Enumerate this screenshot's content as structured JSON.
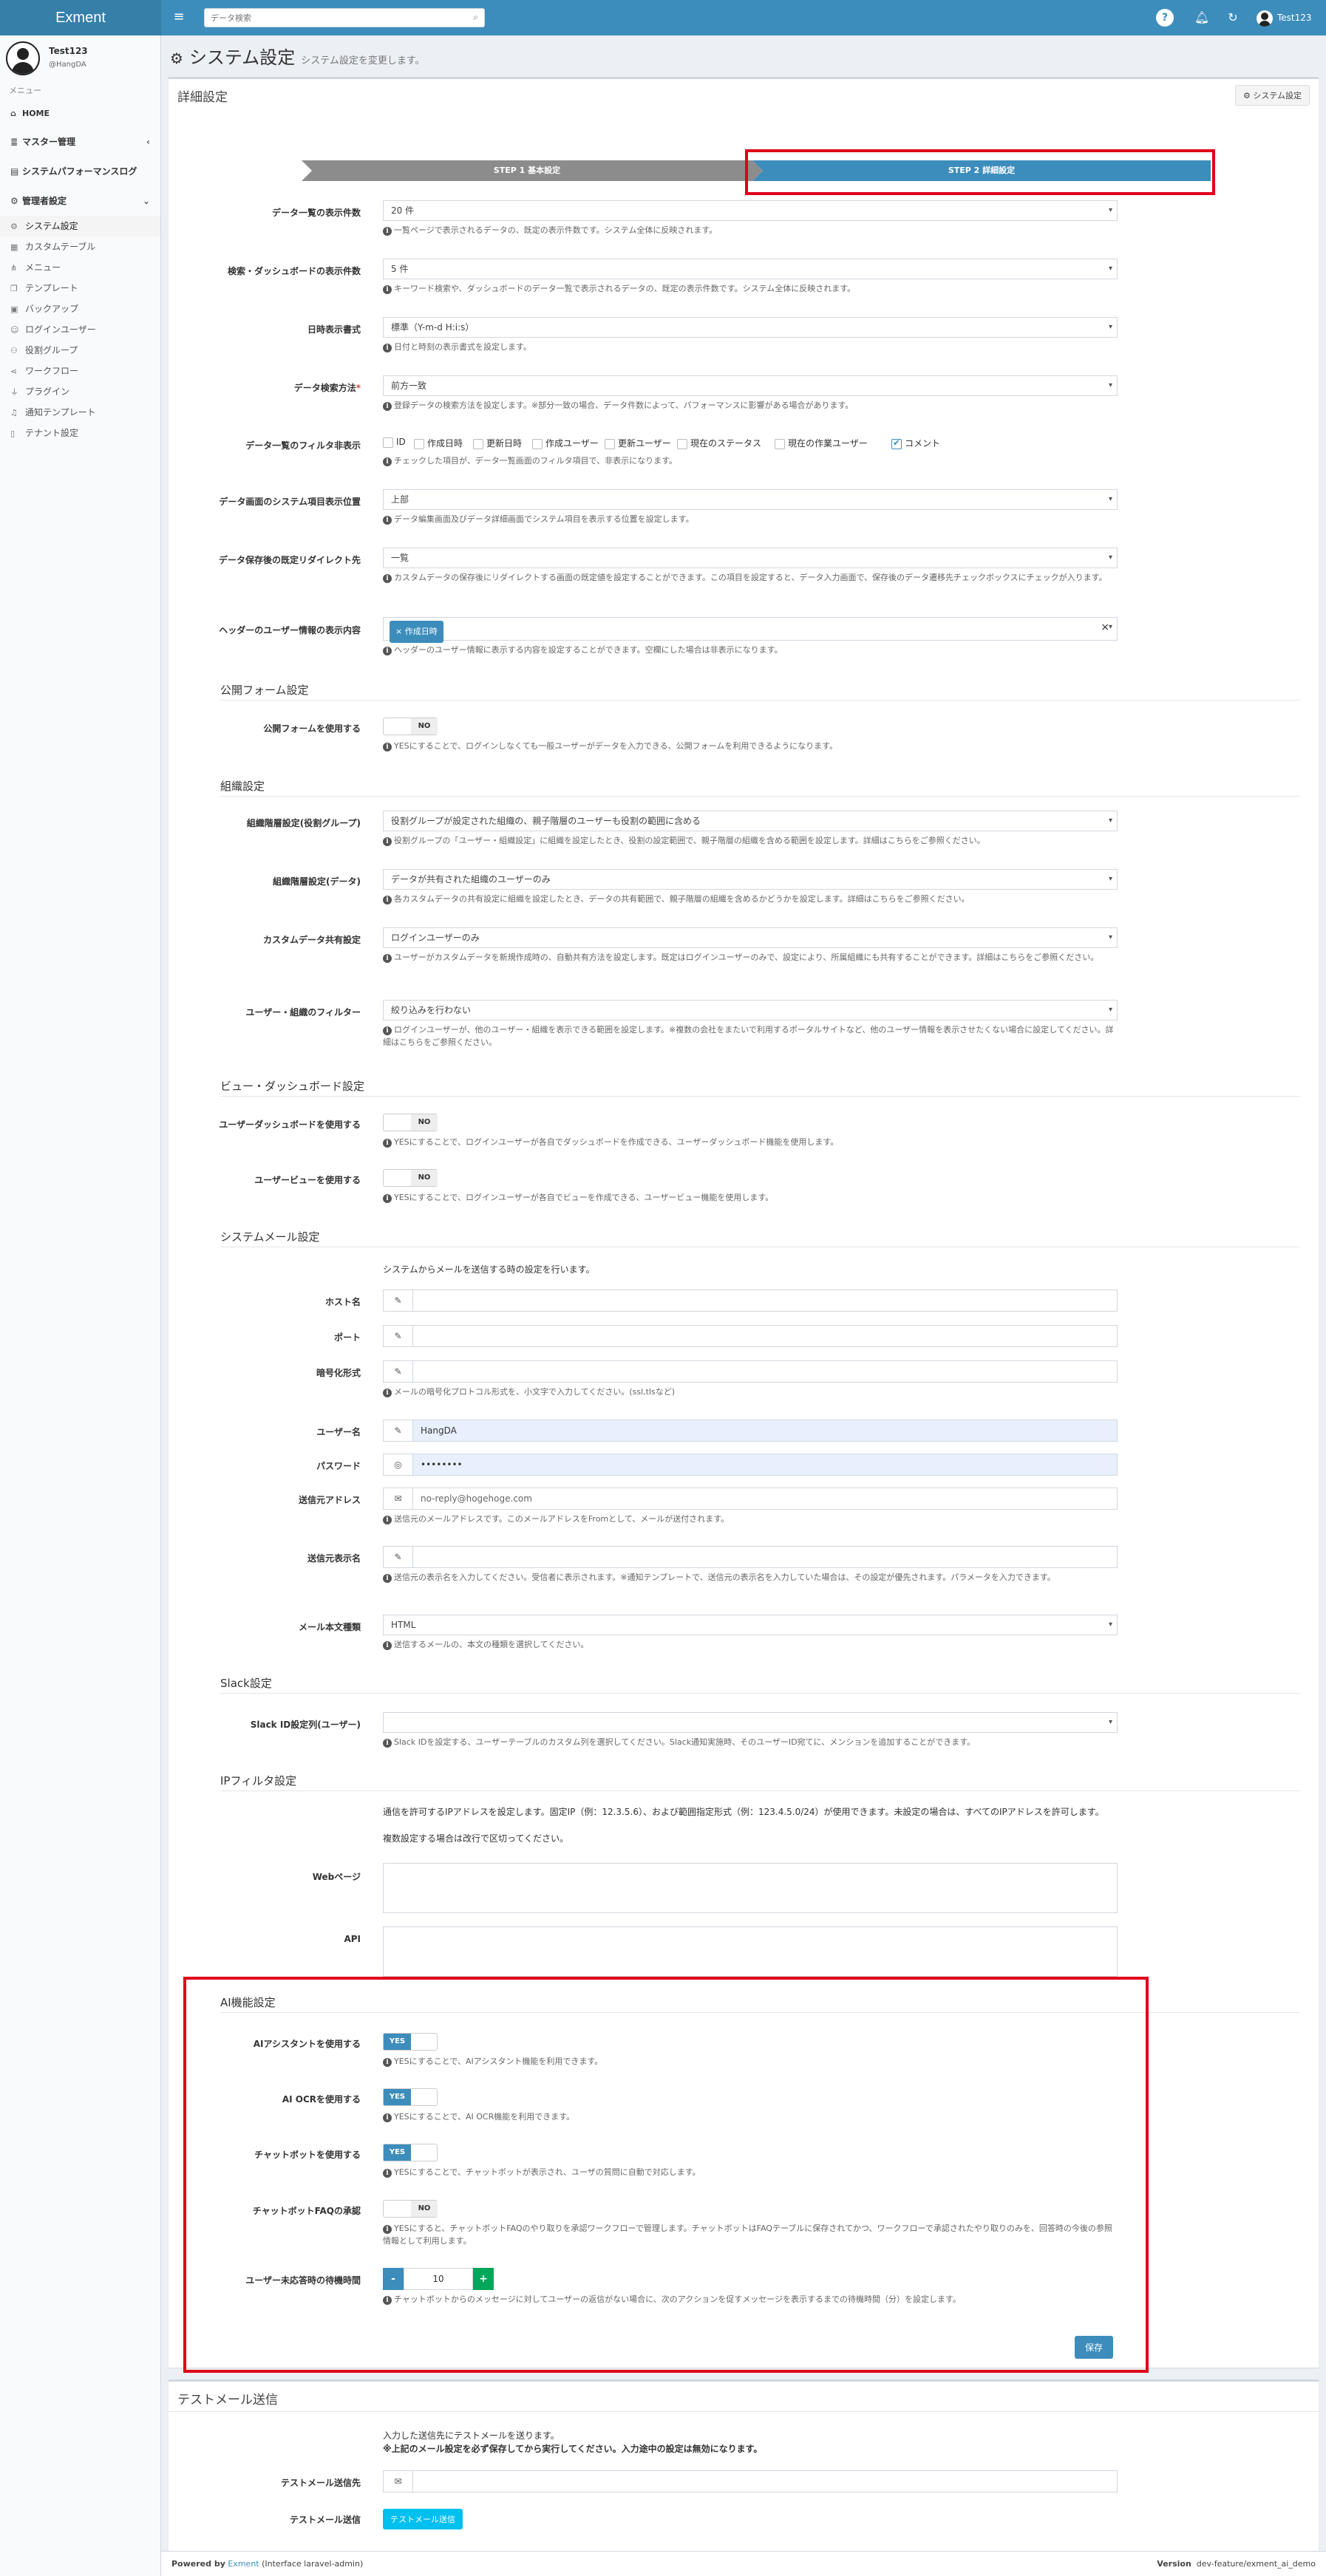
{
  "app": {
    "logo": "Exment",
    "user_name": "Test123"
  },
  "search": {
    "placeholder": "データ検索"
  },
  "sidebar": {
    "user_name": "Test123",
    "user_id": "@HangDA",
    "menu_header": "メニュー",
    "items": [
      {
        "label": "HOME",
        "icon": "home-icon"
      },
      {
        "label": "マスター管理",
        "icon": "database-icon"
      },
      {
        "label": "システムパフォーマンスログ",
        "icon": "log-icon"
      },
      {
        "label": "管理者設定",
        "icon": "gear-icon"
      }
    ],
    "sub_items": [
      "システム設定",
      "カスタムテーブル",
      "メニュー",
      "テンプレート",
      "バックアップ",
      "ログインユーザー",
      "役割グループ",
      "ワークフロー",
      "プラグイン",
      "通知テンプレート",
      "テナント設定"
    ]
  },
  "page": {
    "title": "システム設定",
    "subtitle": "システム設定を変更します。"
  },
  "detail_box": {
    "title": "詳細設定",
    "setting_button": "システム設定",
    "step1": "STEP 1 基本設定",
    "step2": "STEP 2 詳細設定",
    "rows": [
      {
        "label": "データ一覧の表示件数",
        "value": "20 件",
        "help": "一覧ページで表示されるデータの、既定の表示件数です。システム全体に反映されます。"
      },
      {
        "label": "検索・ダッシュボードの表示件数",
        "value": "5 件",
        "help": "キーワード検索や、ダッシュボードのデータ一覧で表示されるデータの、既定の表示件数です。システム全体に反映されます。"
      },
      {
        "label": "日時表示書式",
        "value": "標準（Y-m-d H:i:s）",
        "help": "日付と時刻の表示書式を設定します。"
      },
      {
        "label": "データ検索方法",
        "value": "前方一致",
        "help": "登録データの検索方法を設定します。※部分一致の場合、データ件数によって、パフォーマンスに影響がある場合があります。"
      },
      {
        "label": "データ画面のシステム項目表示位置",
        "value": "上部",
        "help": "データ編集画面及びデータ詳細画面でシステム項目を表示する位置を設定します。"
      },
      {
        "label": "データ保存後の既定リダイレクト先",
        "value": "一覧",
        "help": "カスタムデータの保存後にリダイレクトする画面の既定値を設定することができます。この項目を設定すると、データ入力画面で、保存後のデータ遷移先チェックボックスにチェックが入ります。"
      }
    ],
    "filter_row": {
      "label": "データ一覧のフィルタ非表示",
      "options": [
        "ID",
        "作成日時",
        "更新日時",
        "作成ユーザー",
        "更新ユーザー",
        "現在のステータス",
        "現在の作業ユーザー",
        "コメント"
      ],
      "checked": "コメント",
      "help": "チェックした項目が、データ一覧画面のフィルタ項目で、非表示になります。"
    },
    "header_row": {
      "label": "ヘッダーのユーザー情報の表示内容",
      "tag": "× 作成日時",
      "clear": "×",
      "help": "ヘッダーのユーザー情報に表示する内容を設定することができます。空欄にした場合は非表示になります。"
    },
    "public_form": {
      "title": "公開フォーム設定",
      "label": "公開フォームを使用する",
      "toggle": "NO",
      "help": "YESにすることで、ログインしなくても一般ユーザーがデータを入力できる、公開フォームを利用できるようになります。"
    },
    "org": {
      "title": "組織設定",
      "rows": [
        {
          "label": "組織階層設定(役割グループ)",
          "value": "役割グループが設定された組織の、親子階層のユーザーも役割の範囲に含める",
          "help": "役割グループの「ユーザー・組織設定」に組織を設定したとき、役割の設定範囲で、親子階層の組織を含める範囲を設定します。詳細はこちらをご参照ください。"
        },
        {
          "label": "組織階層設定(データ)",
          "value": "データが共有された組織のユーザーのみ",
          "help": "各カスタムデータの共有設定に組織を設定したとき、データの共有範囲で、親子階層の組織を含めるかどうかを設定します。詳細はこちらをご参照ください。"
        },
        {
          "label": "カスタムデータ共有設定",
          "value": "ログインユーザーのみ",
          "help": "ユーザーがカスタムデータを新規作成時の、自動共有方法を設定します。既定はログインユーザーのみで、設定により、所属組織にも共有することができます。詳細はこちらをご参照ください。"
        },
        {
          "label": "ユーザー・組織のフィルター",
          "value": "絞り込みを行わない",
          "help": "ログインユーザーが、他のユーザー・組織を表示できる範囲を設定します。※複数の会社をまたいで利用するポータルサイトなど、他のユーザー情報を表示させたくない場合に設定してください。詳細はこちらをご参照ください。"
        }
      ]
    },
    "view": {
      "title": "ビュー・ダッシュボード設定",
      "rows": [
        {
          "label": "ユーザーダッシュボードを使用する",
          "toggle": "NO",
          "help": "YESにすることで、ログインユーザーが各自でダッシュボードを作成できる、ユーザーダッシュボード機能を使用します。"
        },
        {
          "label": "ユーザービューを使用する",
          "toggle": "NO",
          "help": "YESにすることで、ログインユーザーが各自でビューを作成できる、ユーザービュー機能を使用します。"
        }
      ]
    },
    "mail": {
      "title": "システムメール設定",
      "desc": "システムからメールを送信する時の設定を行います。",
      "host": "ホスト名",
      "port": "ポート",
      "encryption": "暗号化形式",
      "encryption_help": "メールの暗号化プロトコル形式を、小文字で入力してください。(ssl,tlsなど)",
      "username": "ユーザー名",
      "username_value": "HangDA",
      "password": "パスワード",
      "password_value": "••••••••",
      "from_address": "送信元アドレス",
      "from_address_value": "no-reply@hogehoge.com",
      "from_address_help": "送信元のメールアドレスです。このメールアドレスをFromとして、メールが送付されます。",
      "from_name": "送信元表示名",
      "from_name_help": "送信元の表示名を入力してください。受信者に表示されます。※通知テンプレートで、送信元の表示名を入力していた場合は、その設定が優先されます。パラメータを入力できます。",
      "body_type": "メール本文種類",
      "body_type_value": "HTML",
      "body_type_help": "送信するメールの、本文の種類を選択してください。"
    },
    "slack": {
      "title": "Slack設定",
      "label": "Slack ID設定列(ユーザー)",
      "help": "Slack IDを設定する、ユーザーテーブルのカスタム列を選択してください。Slack通知実施時、そのユーザーID宛てに、メンションを追加することができます。"
    },
    "ip": {
      "title": "IPフィルタ設定",
      "desc1": "通信を許可するIPアドレスを設定します。固定IP（例：12.3.5.6）、および範囲指定形式（例：123.4.5.0/24）が使用できます。未設定の場合は、すべてのIPアドレスを許可します。",
      "desc2": "複数設定する場合は改行で区切ってください。",
      "web": "Webページ",
      "api": "API"
    },
    "ai": {
      "title": "AI機能設定",
      "rows": [
        {
          "label": "AIアシスタントを使用する",
          "toggle": "YES",
          "help": "YESにすることで、AIアシスタント機能を利用できます。"
        },
        {
          "label": "AI OCRを使用する",
          "toggle": "YES",
          "help": "YESにすることで、AI OCR機能を利用できます。"
        },
        {
          "label": "チャットボットを使用する",
          "toggle": "YES",
          "help": "YESにすることで、チャットボットが表示され、ユーザの質問に自動で対応します。"
        },
        {
          "label": "チャットボットFAQの承認",
          "toggle": "NO",
          "help": "YESにすると、チャットボットFAQのやり取りを承認ワークフローで管理します。チャットボットはFAQテーブルに保存されてかつ、ワークフローで承認されたやり取りのみを、回答時の今後の参照情報として利用します。"
        }
      ],
      "wait_label": "ユーザー未応答時の待機時間",
      "wait_value": "10",
      "minus": "-",
      "plus": "+",
      "wait_help": "チャットボットからのメッセージに対してユーザーの返信がない場合に、次のアクションを促すメッセージを表示するまでの待機時間（分）を設定します。"
    },
    "save": "保存"
  },
  "test_box": {
    "title": "テストメール送信",
    "desc1": "入力した送信先にテストメールを送ります。",
    "desc2": "※上記のメール設定を必ず保存してから実行してください。入力途中の設定は無効になります。",
    "to_label": "テストメール送信先",
    "send_label": "テストメール送信",
    "send_button": "テストメール送信"
  },
  "footer": {
    "powered": "Powered by",
    "brand": "Exment",
    "interface": "(Interface laravel-admin)",
    "version_label": "Version",
    "version": "dev-feature/exment_ai_demo"
  }
}
